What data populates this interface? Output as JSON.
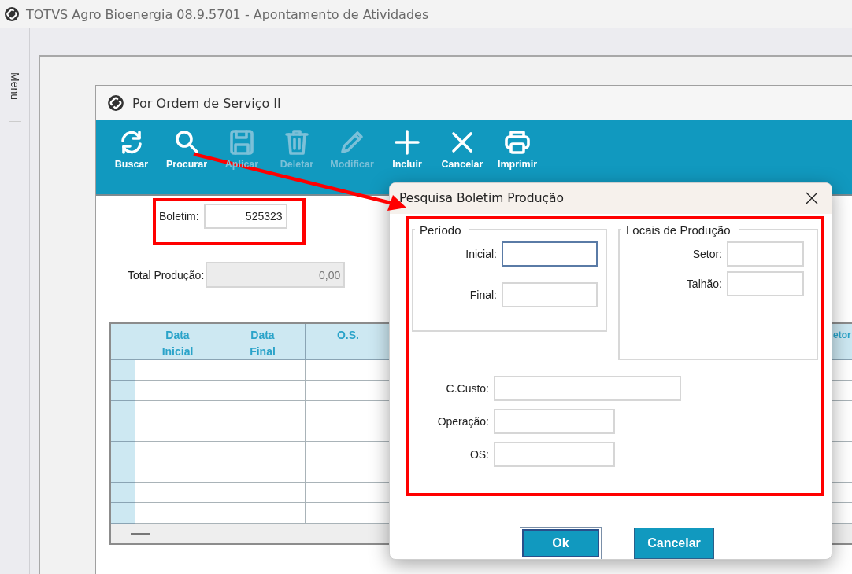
{
  "app_window": {
    "title": "TOTVS Agro Bioenergia 08.9.5701 - Apontamento de Atividades"
  },
  "side_menu": {
    "label": "Menu"
  },
  "child_window": {
    "title": "Por Ordem de Serviço II"
  },
  "toolbar": [
    {
      "label": "Buscar",
      "kind": "refresh",
      "disabled": false
    },
    {
      "label": "Procurar",
      "kind": "search",
      "disabled": false
    },
    {
      "label": "Aplicar",
      "kind": "save",
      "disabled": true
    },
    {
      "label": "Deletar",
      "kind": "trash",
      "disabled": true
    },
    {
      "label": "Modificar",
      "kind": "pencil",
      "disabled": true
    },
    {
      "label": "Incluir",
      "kind": "plus",
      "disabled": false
    },
    {
      "label": "Cancelar",
      "kind": "close",
      "disabled": false
    },
    {
      "label": "Imprimir",
      "kind": "printer",
      "disabled": false
    }
  ],
  "form": {
    "boletim": {
      "label": "Boletim:",
      "value": "525323",
      "disabled": false
    },
    "total": {
      "label": "Total Produção:",
      "value": "0,00",
      "disabled": true
    }
  },
  "grid": {
    "columns": [
      "Data Inicial",
      "Data Final",
      "O.S.",
      "",
      "etor"
    ]
  },
  "dialog": {
    "title": "Pesquisa Boletim Produção",
    "periodo": {
      "title": "Período",
      "fields": [
        {
          "label": "Inicial:",
          "focused": true
        },
        {
          "label": "Final:",
          "focused": false
        }
      ]
    },
    "locais": {
      "title": "Locais de Produção",
      "fields": [
        {
          "label": "Setor:",
          "focused": false
        },
        {
          "label": "Talhão:",
          "focused": false
        }
      ]
    },
    "fields": [
      {
        "label": "C.Custo:",
        "focused": false
      },
      {
        "label": "Operação:",
        "focused": false
      },
      {
        "label": "OS:",
        "focused": false
      }
    ],
    "buttons": [
      {
        "label": "Ok",
        "default": true
      },
      {
        "label": "Cancelar",
        "default": false
      }
    ]
  }
}
